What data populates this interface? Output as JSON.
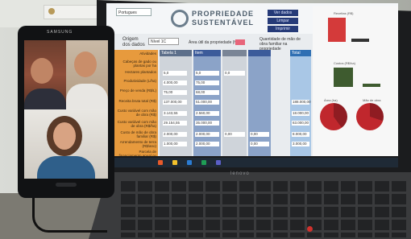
{
  "app": {
    "selector_value": "Portugues",
    "brand_line1": "PROPRIEDADE",
    "brand_line2": "SUSTENTÁVEL",
    "nav_buttons": [
      "Ver dados",
      "Limpar",
      "Imprimir"
    ],
    "origin_label_1": "Origem",
    "origin_label_2": "dos dados",
    "origin_value": "Nível 1C",
    "area_text": "Área útil da propriedade (ha)",
    "quantity_text": "Quantidade de mão de obra familiar na propriedade",
    "column_heads": [
      "Tabela 1",
      "Item",
      "",
      "",
      "",
      "Total"
    ],
    "row_labels": [
      "Atividades",
      "Cabeças de gado ou plantas por ha",
      "Hectares plantados",
      "Produtividade (L/ha)",
      "Preço de venda (R$/L)",
      "Receita bruta total (R$)",
      "Custo variável com mão de obra (R$)",
      "Custo variável com mão de obra (R$/ha)",
      "Custo de mão de obra familiar (R$)",
      "Arrendamento de terra (R$/ano)",
      "Parcela de financiamento anual ou ano (R$)"
    ],
    "col1_values": [
      "5,0",
      "4.000,00",
      "75,00",
      "137.000,00",
      "3.143,55",
      "29.154,55",
      "2.000,00",
      "1.000,00"
    ],
    "col2_values": [
      "5,0",
      "75,00",
      "68,00",
      "51.000,00",
      "2.560,00",
      "35.000,00",
      "2.000,00",
      "2.000,00"
    ],
    "col3_values": [
      "0,0",
      "0,00",
      "0,00",
      "0,00"
    ],
    "total_values": [
      "188.000,00",
      "18.000,00",
      "63.000,00",
      "8.000,00",
      "3.000,00"
    ],
    "chart_titles": [
      "Receitas (R$)",
      "Custos (R$/ha)",
      "Área (ha)",
      "Mão de obra"
    ]
  },
  "laptop": {
    "brand": "lenovo"
  },
  "phone": {
    "brand": "SAMSUNG"
  },
  "colors": {
    "accent_orange": "#e79a3d",
    "accent_blue": "#253a78",
    "pie_red": "#c0272d",
    "bar_red": "#d43a3a",
    "bar_green": "#3e5b2f"
  }
}
